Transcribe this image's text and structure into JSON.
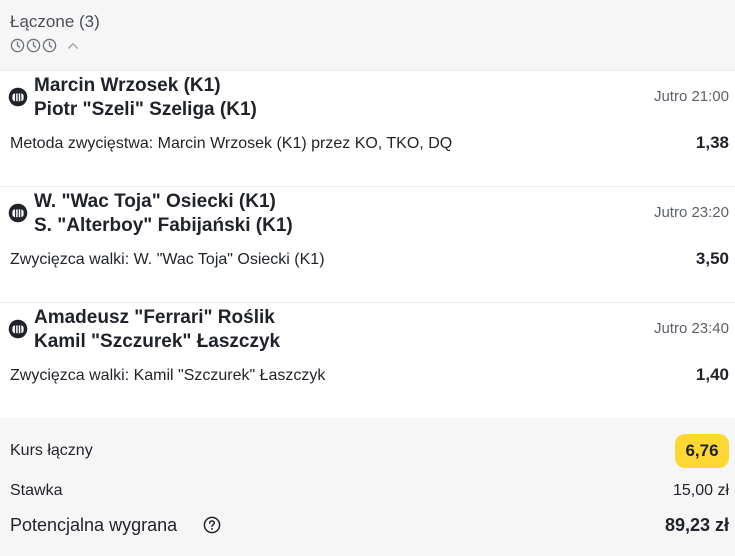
{
  "header": {
    "title": "Łączone (3)"
  },
  "bets": [
    {
      "team1": "Marcin Wrzosek (K1)",
      "team2": "Piotr \"Szeli\" Szeliga (K1)",
      "time": "Jutro 21:00",
      "market": "Metoda zwycięstwa: Marcin Wrzosek (K1) przez KO, TKO, DQ",
      "odds": "1,38"
    },
    {
      "team1": "W. \"Wac Toja\" Osiecki (K1)",
      "team2": "S. \"Alterboy\" Fabijański (K1)",
      "time": "Jutro 23:20",
      "market": "Zwycięzca walki: W. \"Wac Toja\" Osiecki (K1)",
      "odds": "3,50"
    },
    {
      "team1": "Amadeusz \"Ferrari\" Roślik",
      "team2": "Kamil \"Szczurek\" Łaszczyk",
      "time": "Jutro 23:40",
      "market": "Zwycięzca walki: Kamil \"Szczurek\" Łaszczyk",
      "odds": "1,40"
    }
  ],
  "summary": {
    "total_odds_label": "Kurs łączny",
    "total_odds_value": "6,76",
    "stake_label": "Stawka",
    "stake_value": "15,00 zł",
    "potential_win_label": "Potencjalna wygrana",
    "potential_win_value": "89,23 zł"
  },
  "colors": {
    "accent": "#fdd835",
    "background": "#f6f6f7"
  }
}
